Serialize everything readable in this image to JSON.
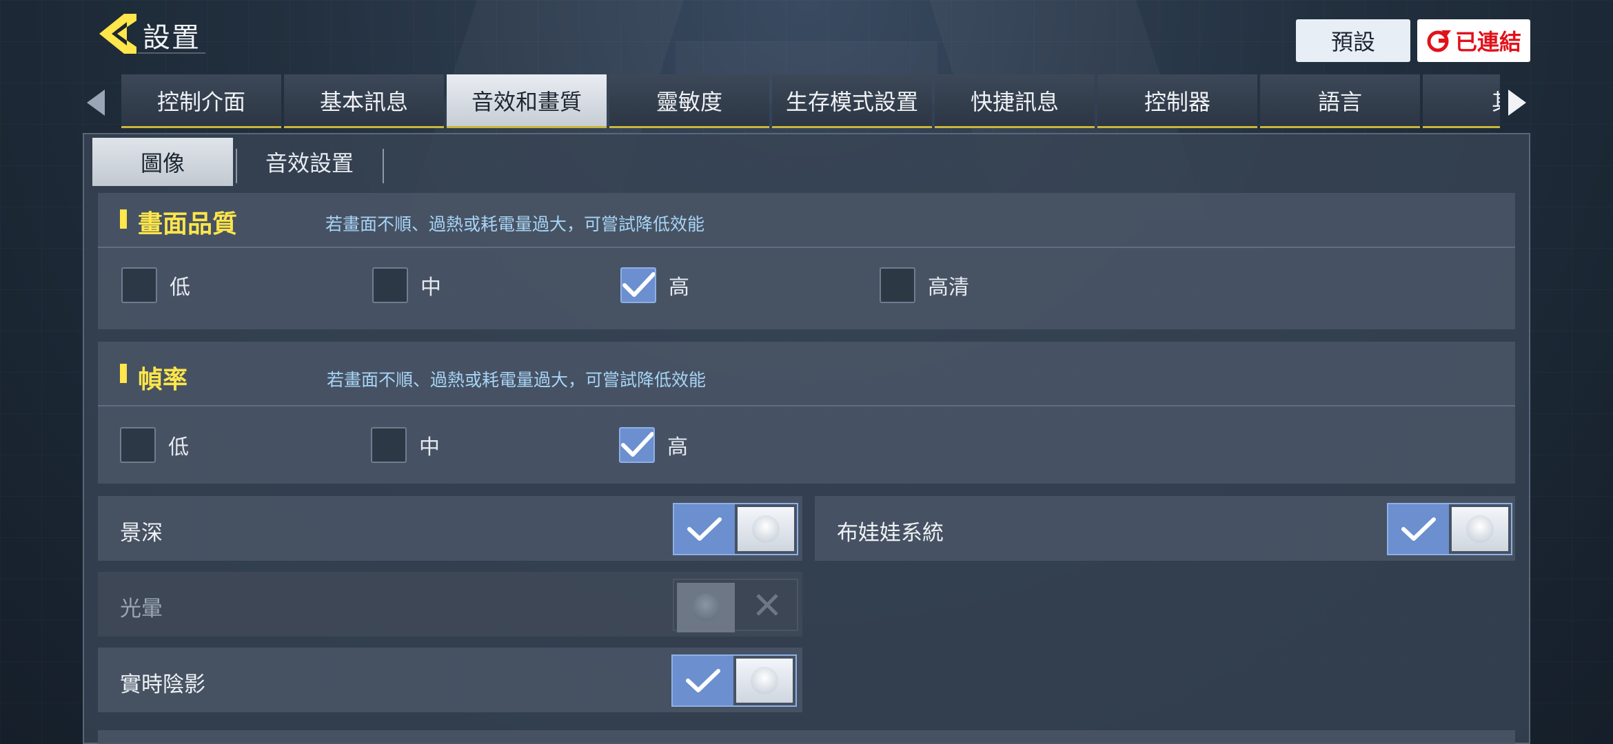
{
  "header": {
    "title": "設置",
    "preset_label": "預設",
    "connected_label": "已連結",
    "back_icon": "back-arrow-icon"
  },
  "tabs": [
    {
      "label": "控制介面"
    },
    {
      "label": "基本訊息"
    },
    {
      "label": "音效和畫質",
      "active": true
    },
    {
      "label": "靈敏度"
    },
    {
      "label": "生存模式設置"
    },
    {
      "label": "快捷訊息"
    },
    {
      "label": "控制器"
    },
    {
      "label": "語言"
    },
    {
      "label": "其"
    }
  ],
  "subtabs": [
    {
      "label": "圖像",
      "active": true
    },
    {
      "label": "音效設置"
    }
  ],
  "quality": {
    "title": "畫面品質",
    "hint": "若畫面不順、過熱或耗電量過大，可嘗試降低效能",
    "options": [
      {
        "label": "低",
        "checked": false
      },
      {
        "label": "中",
        "checked": false
      },
      {
        "label": "高",
        "checked": true
      },
      {
        "label": "高清",
        "checked": false
      }
    ]
  },
  "framerate": {
    "title": "幀率",
    "hint": "若畫面不順、過熱或耗電量過大，可嘗試降低效能",
    "options": [
      {
        "label": "低",
        "checked": false
      },
      {
        "label": "中",
        "checked": false
      },
      {
        "label": "高",
        "checked": true
      }
    ]
  },
  "toggles": {
    "depth_of_field": {
      "label": "景深",
      "on": true
    },
    "ragdoll": {
      "label": "布娃娃系統",
      "on": true
    },
    "bloom": {
      "label": "光暈",
      "on": false,
      "disabled": true
    },
    "realtime_shadow": {
      "label": "實時陰影",
      "on": true
    }
  },
  "colors": {
    "accent_yellow": "#ffe64a",
    "hint_blue": "#a8d4f6",
    "toggle_blue": "#6b8fcf",
    "tab_underline": "#c9b73a",
    "connected_red": "#e0121b"
  }
}
